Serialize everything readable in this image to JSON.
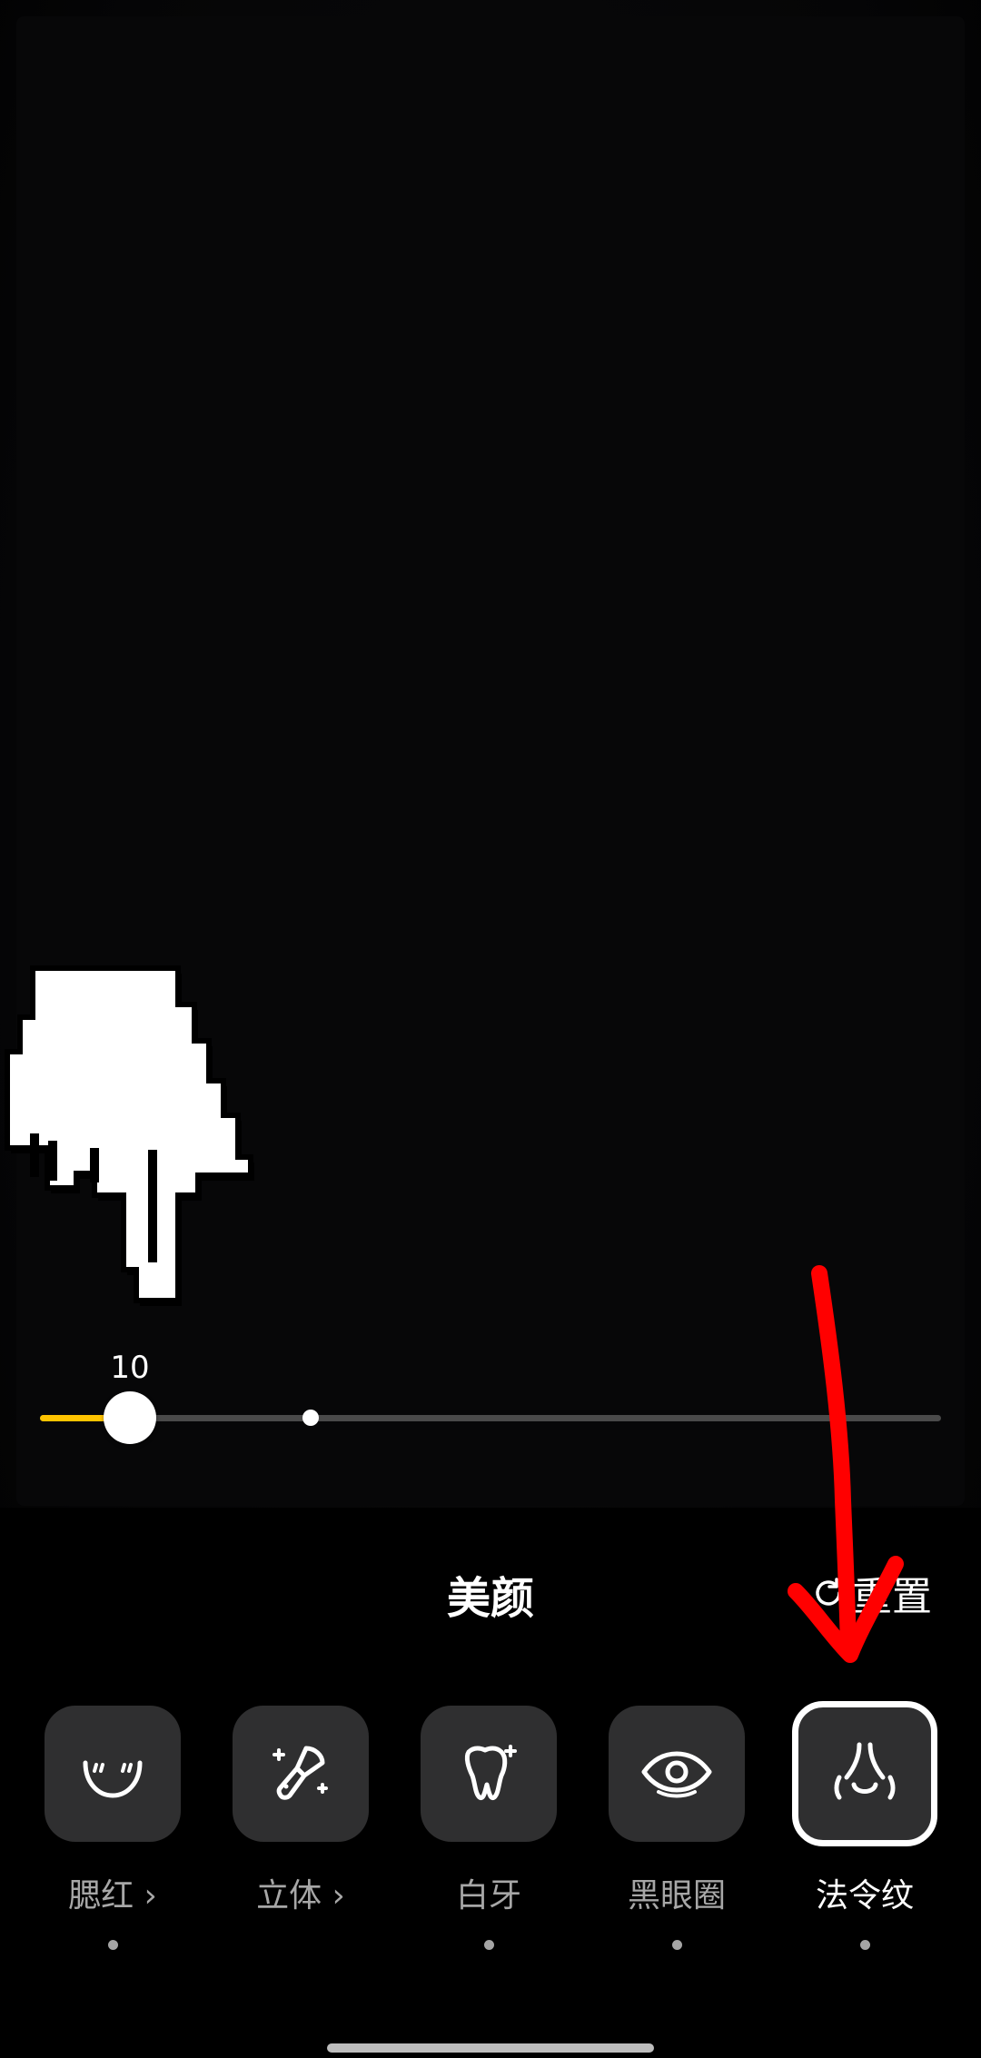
{
  "slider": {
    "value_label": "10",
    "value_fraction": 0.1,
    "default_fraction": 0.3,
    "fill_color": "#ffc400",
    "track_color": "#4a4a4a"
  },
  "panel": {
    "title": "美颜",
    "reset_label": "重置",
    "reset_icon": "reset-arrow-icon"
  },
  "tools": [
    {
      "label": "腮红 ›",
      "icon": "blush-face-icon",
      "has_dot": true,
      "selected": false
    },
    {
      "label": "立体 ›",
      "icon": "contour-brush-icon",
      "has_dot": false,
      "selected": false
    },
    {
      "label": "白牙",
      "icon": "tooth-sparkle-icon",
      "has_dot": true,
      "selected": false
    },
    {
      "label": "黑眼圈",
      "icon": "eye-icon",
      "has_dot": true,
      "selected": false
    },
    {
      "label": "法令纹",
      "icon": "nose-icon",
      "has_dot": true,
      "selected": true
    }
  ],
  "annotations": {
    "pointer": "pixel-hand-pointer-icon",
    "arrow": "red-arrow-icon",
    "arrow_color": "#ff0000"
  }
}
